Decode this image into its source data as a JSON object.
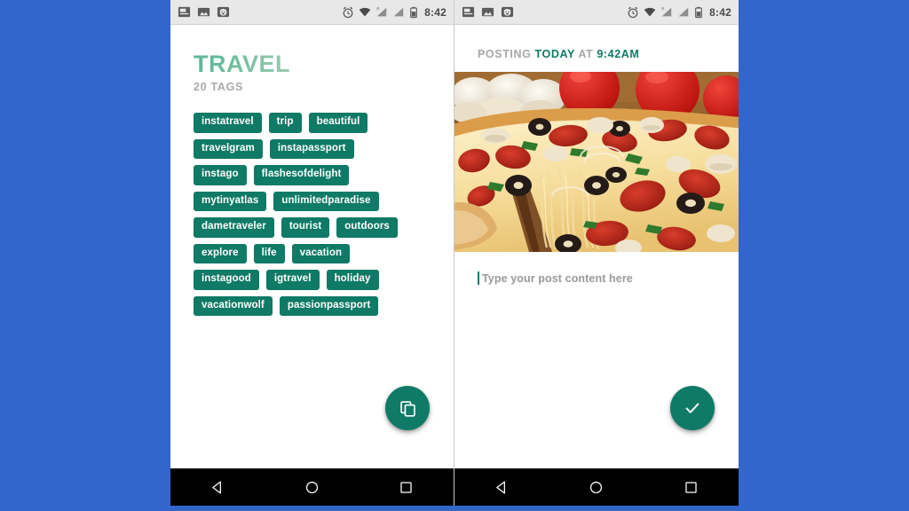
{
  "background_color": "#3366cc",
  "accent_color": "#0f7a66",
  "title_color": "#62b596",
  "muted_color": "#a9a9a9",
  "status_bar": {
    "time": "8:42",
    "icons_left": [
      "news-icon",
      "image-icon",
      "piggy-icon"
    ],
    "icons_right": [
      "alarm-icon",
      "wifi-icon",
      "signal-roaming-icon",
      "signal-icon",
      "battery-icon"
    ]
  },
  "left_panel": {
    "title": "TRAVEL",
    "tag_count_label": "20 TAGS",
    "tags": [
      "instatravel",
      "trip",
      "beautiful",
      "travelgram",
      "instapassport",
      "instago",
      "flashesofdelight",
      "mytinyatlas",
      "unlimitedparadise",
      "dametraveler",
      "tourist",
      "outdoors",
      "explore",
      "life",
      "vacation",
      "instagood",
      "igtravel",
      "holiday",
      "vacationwolf",
      "passionpassport"
    ],
    "fab_icon": "copy-icon"
  },
  "right_panel": {
    "posting_prefix": "POSTING",
    "posting_day": "TODAY",
    "posting_at": "AT",
    "posting_time": "9:42AM",
    "photo_alt": "pizza-photo",
    "composer_placeholder": "Type your post content here",
    "fab_icon": "check-icon"
  },
  "nav_bar": {
    "back_label": "back-icon",
    "home_label": "home-icon",
    "recents_label": "recents-icon"
  }
}
